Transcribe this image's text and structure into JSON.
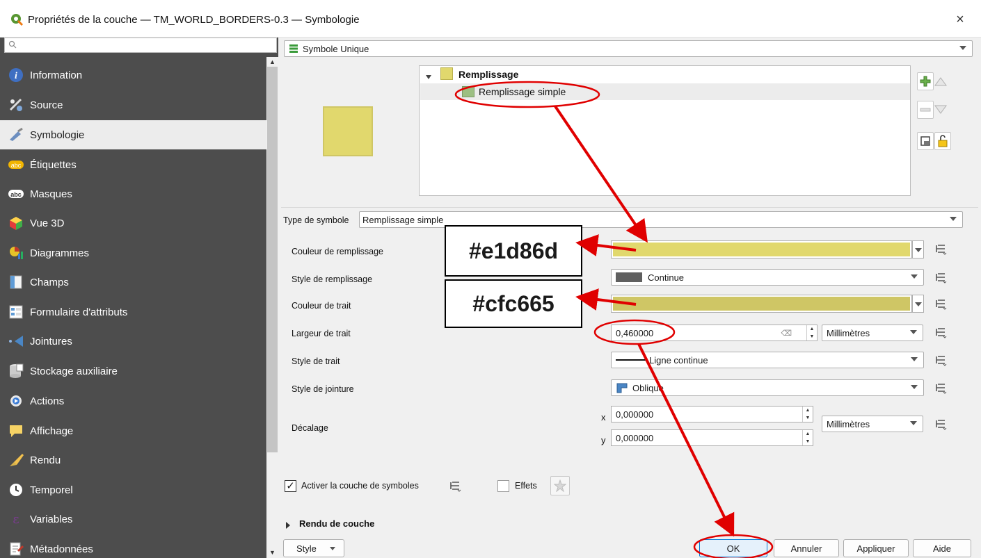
{
  "window": {
    "title": "Propriétés de la couche — TM_WORLD_BORDERS-0.3 — Symbologie",
    "close": "×"
  },
  "sidebar": {
    "search_placeholder": "",
    "items": [
      {
        "label": "Information",
        "icon": "info-icon"
      },
      {
        "label": "Source",
        "icon": "source-icon"
      },
      {
        "label": "Symbologie",
        "icon": "symbology-icon"
      },
      {
        "label": "Étiquettes",
        "icon": "labels-icon"
      },
      {
        "label": "Masques",
        "icon": "masks-icon"
      },
      {
        "label": "Vue 3D",
        "icon": "cube-icon"
      },
      {
        "label": "Diagrammes",
        "icon": "diagram-icon"
      },
      {
        "label": "Champs",
        "icon": "fields-icon"
      },
      {
        "label": "Formulaire d'attributs",
        "icon": "form-icon"
      },
      {
        "label": "Jointures",
        "icon": "joins-icon"
      },
      {
        "label": "Stockage auxiliaire",
        "icon": "storage-icon"
      },
      {
        "label": "Actions",
        "icon": "actions-icon"
      },
      {
        "label": "Affichage",
        "icon": "display-icon"
      },
      {
        "label": "Rendu",
        "icon": "render-icon"
      },
      {
        "label": "Temporel",
        "icon": "clock-icon"
      },
      {
        "label": "Variables",
        "icon": "variables-icon"
      },
      {
        "label": "Métadonnées",
        "icon": "metadata-icon"
      }
    ],
    "active": "Symbologie"
  },
  "renderer": {
    "selected": "Symbole Unique"
  },
  "tree": {
    "root": "Remplissage",
    "child": "Remplissage simple"
  },
  "colors": {
    "fill": "#e1d86d",
    "stroke": "#cfc665",
    "annotation": "#e00000"
  },
  "symbol_type": {
    "label": "Type de symbole",
    "value": "Remplissage simple"
  },
  "props": {
    "fill_color": "Couleur de remplissage",
    "fill_style": "Style de remplissage",
    "fill_style_value": "Continue",
    "stroke_color": "Couleur de trait",
    "stroke_width": "Largeur de trait",
    "stroke_width_value": "0,460000",
    "stroke_unit": "Millimètres",
    "stroke_style": "Style de trait",
    "stroke_style_value": "Ligne continue",
    "join_style": "Style de jointure",
    "join_style_value": "Oblique",
    "offset": "Décalage",
    "offset_x_label": "x",
    "offset_x": "0,000000",
    "offset_y_label": "y",
    "offset_y": "0,000000",
    "offset_unit": "Millimètres"
  },
  "annotations": {
    "fill_hex": "#e1d86d",
    "stroke_hex": "#cfc665"
  },
  "layer": {
    "enable_label": "Activer la couche de symboles",
    "enable_checked": true,
    "effects_label": "Effets",
    "effects_checked": false
  },
  "rendering": {
    "label": "Rendu de couche"
  },
  "footer": {
    "style": "Style",
    "ok": "OK",
    "cancel": "Annuler",
    "apply": "Appliquer",
    "help": "Aide"
  }
}
